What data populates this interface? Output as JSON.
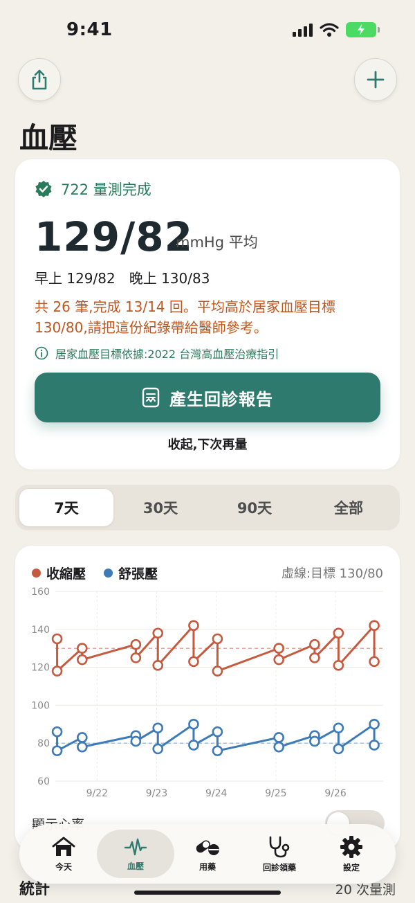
{
  "status_bar": {
    "time": "9:41"
  },
  "header": {
    "title": "血壓"
  },
  "summary": {
    "verified_text": "722 量測完成",
    "average_value": "129/82",
    "average_unit": "mmHg 平均",
    "am_pm_text": "早上 129/82　晚上 130/83",
    "warning_text": "共 26 筆,完成 13/14 回。平均高於居家血壓目標 130/80,請把這份紀錄帶給醫師參考。",
    "info_text": "居家血壓目標依據:2022 台灣高血壓治療指引",
    "report_button_label": "產生回診報告",
    "later_label": "收起,下次再量"
  },
  "range_tabs": [
    {
      "label": "7天",
      "active": true
    },
    {
      "label": "30天",
      "active": false
    },
    {
      "label": "90天",
      "active": false
    },
    {
      "label": "全部",
      "active": false
    }
  ],
  "chart_card": {
    "target_note": "虛線:目標 130/80",
    "heart_rate_toggle_label": "顯示心率",
    "heart_rate_toggle_on": false
  },
  "chart_data": {
    "type": "line",
    "y_ticks": [
      60,
      80,
      100,
      120,
      140,
      160
    ],
    "ylim": [
      60,
      160
    ],
    "x_ticks": [
      {
        "label": "9/22",
        "x": 1
      },
      {
        "label": "9/23",
        "x": 2
      },
      {
        "label": "9/24",
        "x": 3
      },
      {
        "label": "9/25",
        "x": 4
      },
      {
        "label": "9/26",
        "x": 5
      }
    ],
    "x_range": [
      0.3,
      5.8
    ],
    "targets": {
      "systolic": 130,
      "diastolic": 80
    },
    "series": [
      {
        "name": "收縮壓",
        "color": "#c65a3e",
        "readings": [
          {
            "x": 0.33,
            "values": [
              135,
              118
            ]
          },
          {
            "x": 0.75,
            "values": [
              130,
              124
            ]
          },
          {
            "x": 1.65,
            "values": [
              132,
              125
            ]
          },
          {
            "x": 2.02,
            "values": [
              138,
              121
            ]
          },
          {
            "x": 2.62,
            "values": [
              142,
              123
            ]
          },
          {
            "x": 3.02,
            "values": [
              135,
              118
            ]
          },
          {
            "x": 4.05,
            "values": [
              130,
              124
            ]
          },
          {
            "x": 4.65,
            "values": [
              132,
              125
            ]
          },
          {
            "x": 5.05,
            "values": [
              138,
              121
            ]
          },
          {
            "x": 5.65,
            "values": [
              142,
              123
            ]
          }
        ]
      },
      {
        "name": "舒張壓",
        "color": "#3d7ab8",
        "readings": [
          {
            "x": 0.33,
            "values": [
              86,
              76
            ]
          },
          {
            "x": 0.75,
            "values": [
              83,
              78
            ]
          },
          {
            "x": 1.65,
            "values": [
              84,
              81
            ]
          },
          {
            "x": 2.02,
            "values": [
              88,
              77
            ]
          },
          {
            "x": 2.62,
            "values": [
              90,
              79
            ]
          },
          {
            "x": 3.02,
            "values": [
              86,
              76
            ]
          },
          {
            "x": 4.05,
            "values": [
              83,
              78
            ]
          },
          {
            "x": 4.65,
            "values": [
              84,
              81
            ]
          },
          {
            "x": 5.05,
            "values": [
              88,
              77
            ]
          },
          {
            "x": 5.65,
            "values": [
              90,
              79
            ]
          }
        ]
      }
    ]
  },
  "tabbar": [
    {
      "label": "今天",
      "icon": "house-icon",
      "active": false
    },
    {
      "label": "血壓",
      "icon": "heartbeat-icon",
      "active": true
    },
    {
      "label": "用藥",
      "icon": "pill-icon",
      "active": false
    },
    {
      "label": "回診領藥",
      "icon": "stethoscope-icon",
      "active": false
    },
    {
      "label": "設定",
      "icon": "gear-icon",
      "active": false
    }
  ],
  "bottom": {
    "stats_label": "統計",
    "count_label": "20 次量測"
  },
  "colors": {
    "accent": "#2e7a6e",
    "warning": "#c0561d",
    "success": "#2a7b5c",
    "systolic": "#c65a3e",
    "diastolic": "#3d7ab8"
  }
}
